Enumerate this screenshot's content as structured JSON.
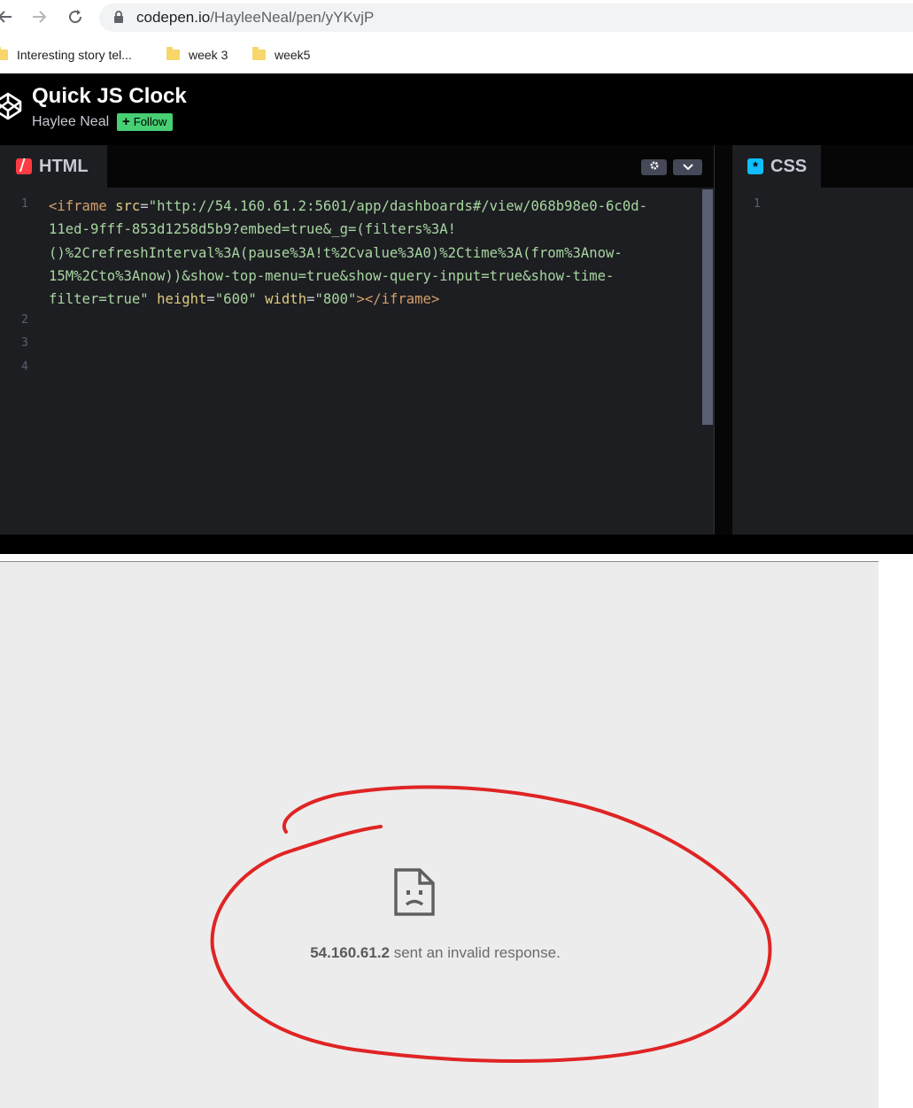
{
  "browser": {
    "url_host": "codepen.io",
    "url_path": "/HayleeNeal/pen/yYKvjP",
    "bookmarks": [
      {
        "label": "Interesting story tel..."
      },
      {
        "label": "week 3"
      },
      {
        "label": "week5"
      }
    ]
  },
  "pen": {
    "title": "Quick JS Clock",
    "author": "Haylee Neal",
    "follow_label": "Follow",
    "follow_plus": "+"
  },
  "editors": {
    "html_tab": "HTML",
    "css_tab": "CSS",
    "html_line_numbers": [
      "1",
      "2",
      "3",
      "4"
    ],
    "css_line_numbers": [
      "1"
    ],
    "code_lines": [
      {
        "open": "<",
        "tag": "iframe",
        "attr1": "src",
        "eq1": "=",
        "val1": "\"http://54.160.61.2:5601/app/dashboards#/view/068b98e0-6c0d-"
      },
      {
        "val": "11ed-9fff-853d1258d5b9?embed=true&_g=(filters%3A!"
      },
      {
        "val": "()%2CrefreshInterval%3A(pause%3A!t%2Cvalue%3A0)%2Ctime%3A(from%3Anow-"
      },
      {
        "val": "15M%2Cto%3Anow))&show-top-menu=true&show-query-input=true&show-time-"
      },
      {
        "val2": "filter=true\"",
        "attr2": "height",
        "eq2": "=",
        "val3": "\"600\"",
        "attr3": "width",
        "eq3": "=",
        "val4": "\"800\"",
        "close": "></",
        "tag_close": "iframe",
        "close2": ">"
      }
    ]
  },
  "preview": {
    "error_host": "54.160.61.2",
    "error_text": " sent an invalid response.",
    "annotation_color": "#e02424"
  },
  "colors": {
    "codepen_green": "#47cf73",
    "html_badge": "#ff3c41",
    "css_badge": "#0ebeff"
  }
}
